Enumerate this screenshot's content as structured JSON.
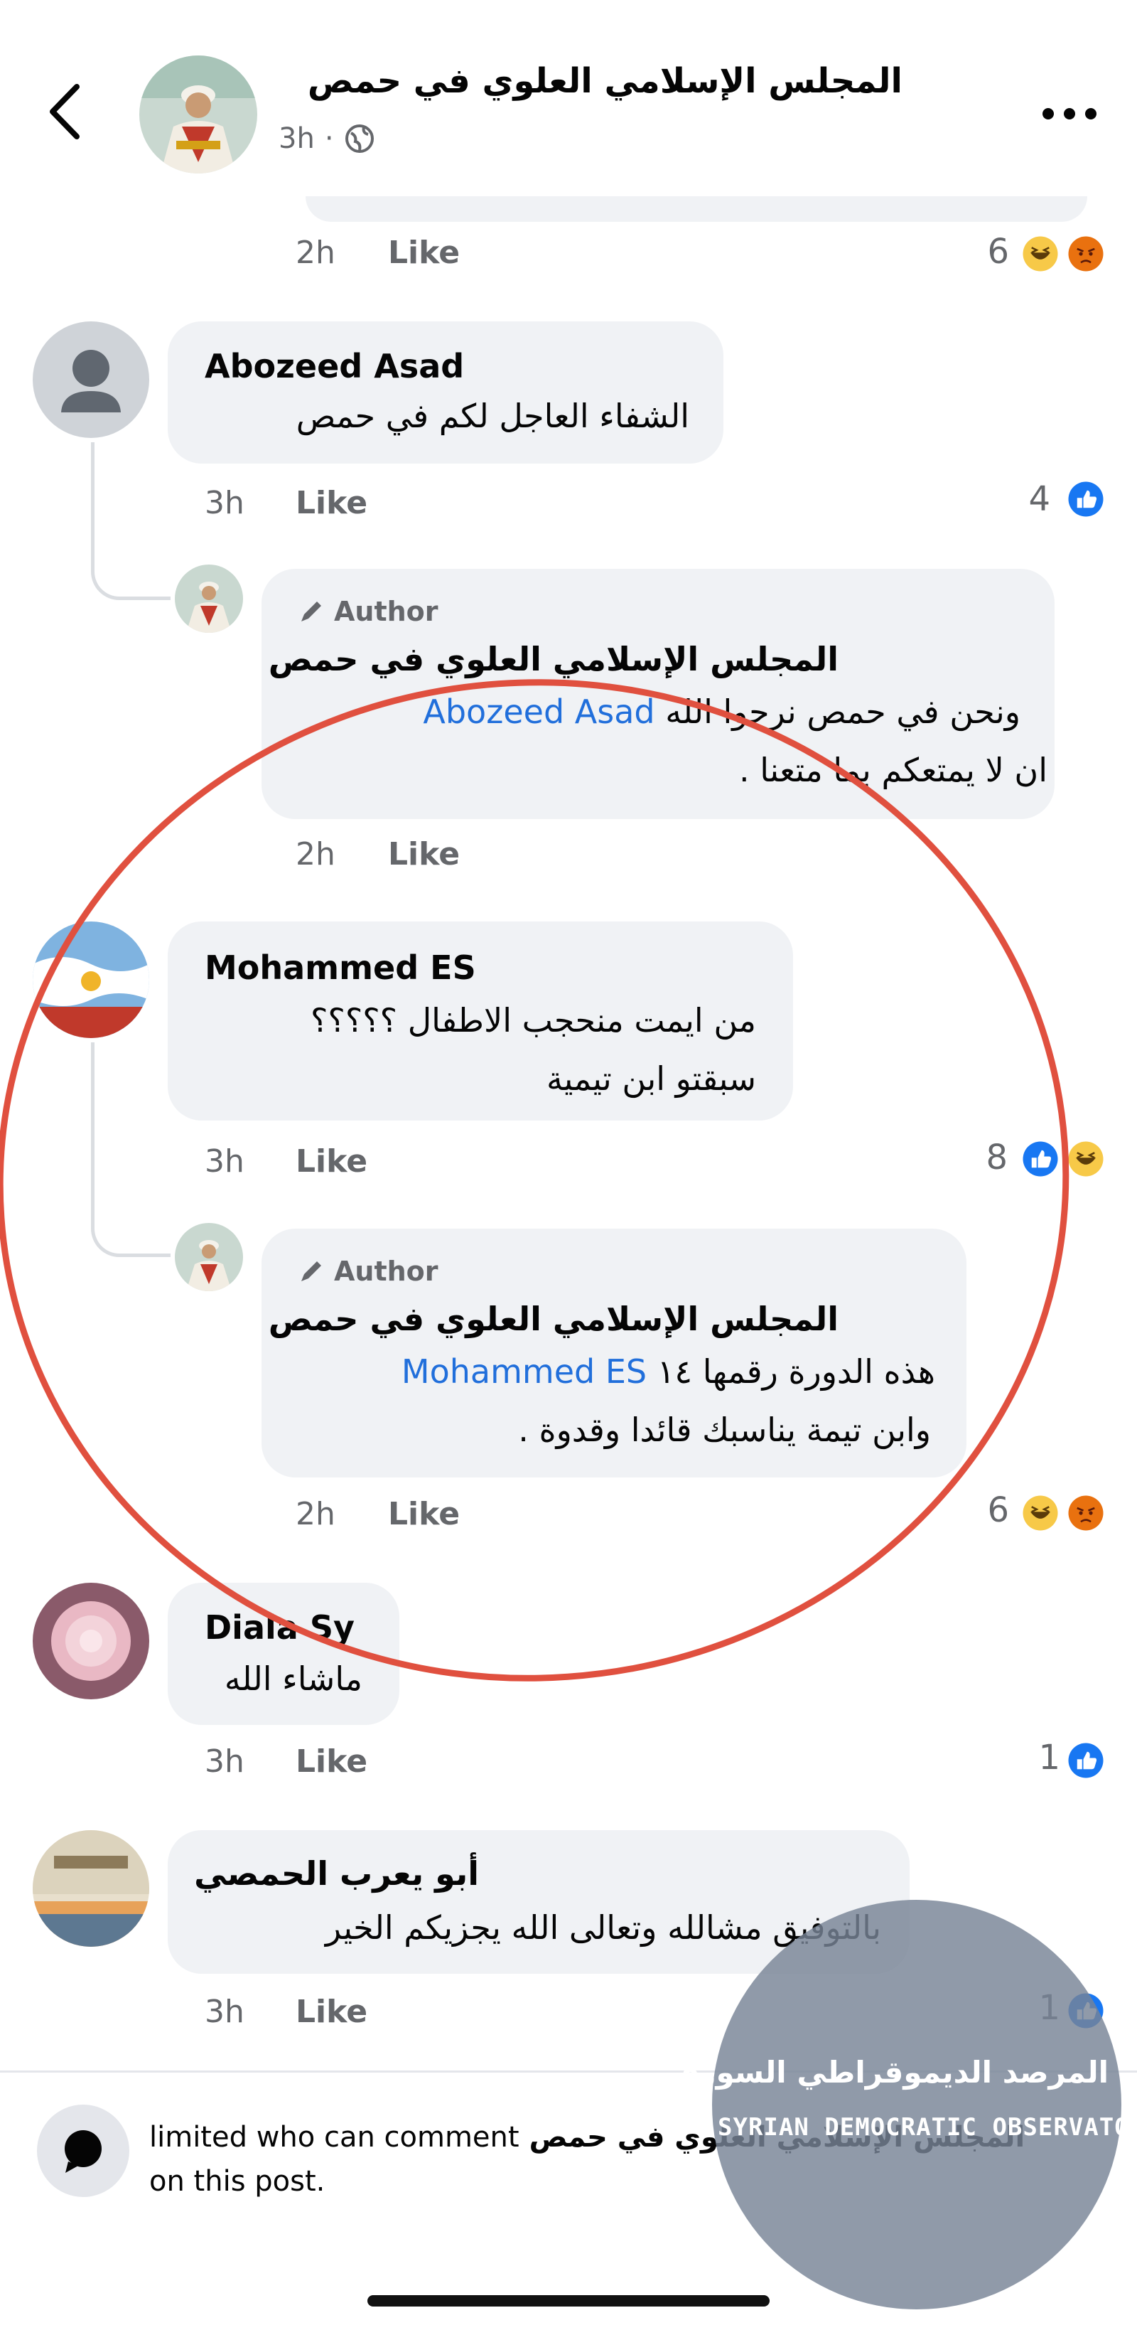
{
  "header": {
    "page_name": "المجلس الإسلامي العلوي في حمص",
    "time": "3h",
    "separator": "·",
    "privacy_icon": "globe-icon",
    "more_icon": "more-dots-icon",
    "back_icon": "chevron-left-icon"
  },
  "comments": [
    {
      "id": "prev",
      "time": "2h",
      "like_label": "Like",
      "reaction_count": "6",
      "reactions": [
        "haha",
        "angry"
      ]
    },
    {
      "id": "abozeed",
      "author": "Abozeed Asad",
      "lines": [
        "الشفاء العاجل لكم في حمص"
      ],
      "time": "3h",
      "like_label": "Like",
      "reaction_count": "4",
      "reactions": [
        "like"
      ]
    },
    {
      "id": "reply1",
      "author_badge": "Author",
      "author": "المجلس الإسلامي العلوي في حمص",
      "mention": "Abozeed Asad",
      "line1_text": "ونحن في حمص نرجوا الله",
      "line2": "ان لا يمتعكم بما متعنا .",
      "time": "2h",
      "like_label": "Like"
    },
    {
      "id": "mohammed",
      "author": "Mohammed ES",
      "lines": [
        "من ايمت منحجب الاطفال ؟؟؟؟؟",
        "سبقتو ابن تيمية"
      ],
      "time": "3h",
      "like_label": "Like",
      "reaction_count": "8",
      "reactions": [
        "like",
        "haha"
      ]
    },
    {
      "id": "reply2",
      "author_badge": "Author",
      "author": "المجلس الإسلامي العلوي في حمص",
      "mention": "Mohammed ES",
      "line1_text": "هذه الدورة رقمها ١٤",
      "line2": "وابن تيمة يناسبك  قائدا وقدوة .",
      "time": "2h",
      "like_label": "Like",
      "reaction_count": "6",
      "reactions": [
        "haha",
        "angry"
      ]
    },
    {
      "id": "diala",
      "author": "Diala Sy",
      "lines": [
        "ماشاء الله"
      ],
      "time": "3h",
      "like_label": "Like",
      "reaction_count": "1",
      "reactions": [
        "like"
      ]
    },
    {
      "id": "abuyarub",
      "author": "أبو يعرب الحمصي",
      "lines": [
        "بالتوفيق مشالله وتعالى الله يجزيكم الخير"
      ],
      "time": "3h",
      "like_label": "Like",
      "reaction_count": "1",
      "reactions": [
        "like"
      ]
    }
  ],
  "footer": {
    "page_name": "المجلس الإسلامي العلوي في حمص",
    "text_after": "limited who can comment",
    "text_line2": "on this post.",
    "icon": "speech-bubble-icon"
  },
  "watermark": {
    "arabic": "المرصد الديموقراطي السوري",
    "english": "SYRIAN DEMOCRATIC OBSERVATORY"
  },
  "colors": {
    "like_blue": "#1877f2",
    "mention_blue": "#216fdb",
    "annotation_red": "#e0503f",
    "bubble_gray": "#f0f2f5",
    "meta_gray": "#65676b"
  }
}
